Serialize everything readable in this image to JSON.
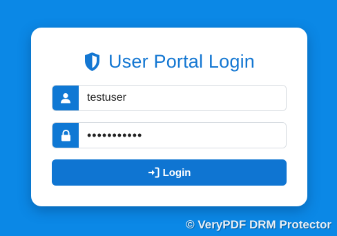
{
  "login": {
    "title": "User Portal Login",
    "username": {
      "value": "testuser",
      "icon": "user-icon"
    },
    "password": {
      "value": "•••••••••••",
      "icon": "lock-icon"
    },
    "button": {
      "label": "Login",
      "icon": "sign-in-icon"
    },
    "title_icon": "shield-icon"
  },
  "watermark": {
    "text": "© VeryPDF DRM Protector"
  },
  "colors": {
    "background": "#0b88e6",
    "accent": "#0f75d2",
    "title": "#1477d2",
    "card": "#ffffff"
  }
}
